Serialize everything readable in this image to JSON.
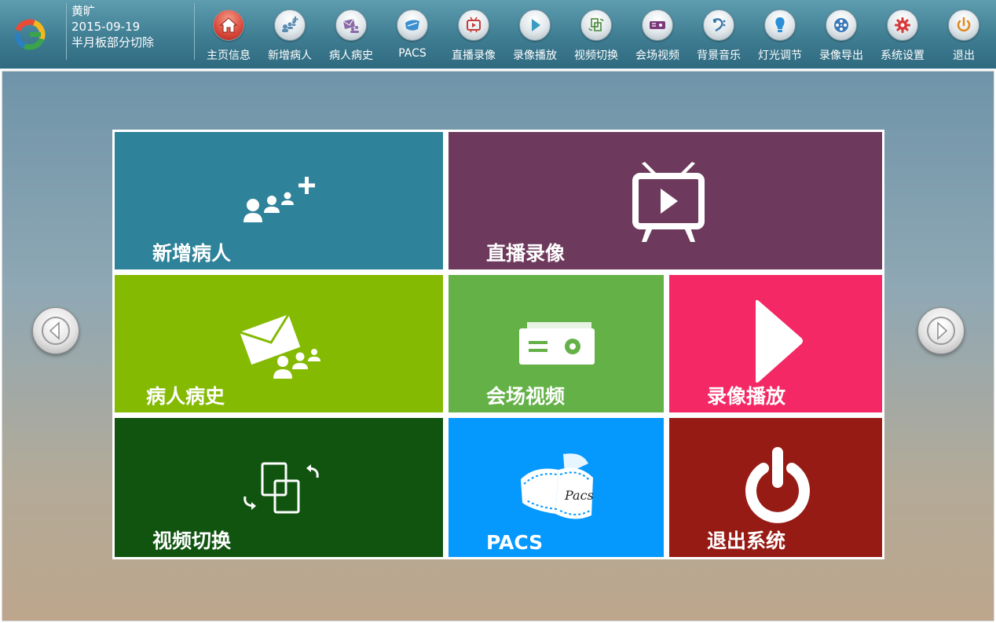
{
  "header": {
    "user_name": "黄旷",
    "date": "2015-09-19",
    "subtitle": "半月板部分切除"
  },
  "nav": [
    {
      "label": "主页信息",
      "icon": "home-icon"
    },
    {
      "label": "新增病人",
      "icon": "add-patient-icon"
    },
    {
      "label": "病人病史",
      "icon": "patient-history-icon"
    },
    {
      "label": "PACS",
      "icon": "pacs-icon"
    },
    {
      "label": "直播录像",
      "icon": "live-tv-icon"
    },
    {
      "label": "录像播放",
      "icon": "play-icon"
    },
    {
      "label": "视频切换",
      "icon": "video-switch-icon"
    },
    {
      "label": "会场视频",
      "icon": "projector-icon"
    },
    {
      "label": "背景音乐",
      "icon": "music-icon"
    },
    {
      "label": "灯光调节",
      "icon": "light-bulb-icon"
    },
    {
      "label": "录像导出",
      "icon": "film-reel-icon"
    },
    {
      "label": "系统设置",
      "icon": "gear-icon"
    },
    {
      "label": "退出",
      "icon": "power-icon"
    }
  ],
  "tiles": {
    "add_patient": {
      "label": "新增病人",
      "color": "#2e8299"
    },
    "live_recording": {
      "label": "直播录像",
      "color": "#6d3a5d"
    },
    "patient_history": {
      "label": "病人病史",
      "color": "#84ba02"
    },
    "venue_video": {
      "label": "会场视频",
      "color": "#64b147"
    },
    "recording_playback": {
      "label": "录像播放",
      "color": "#f32865"
    },
    "video_switch": {
      "label": "视频切换",
      "color": "#105410"
    },
    "pacs": {
      "label": "PACS",
      "color": "#0599fd"
    },
    "exit_system": {
      "label": "退出系统",
      "color": "#971b15"
    }
  },
  "pacs_icon_text": "Pacs",
  "colors": {
    "topbar": "#3f7d92",
    "accent_red": "#d9483a"
  }
}
